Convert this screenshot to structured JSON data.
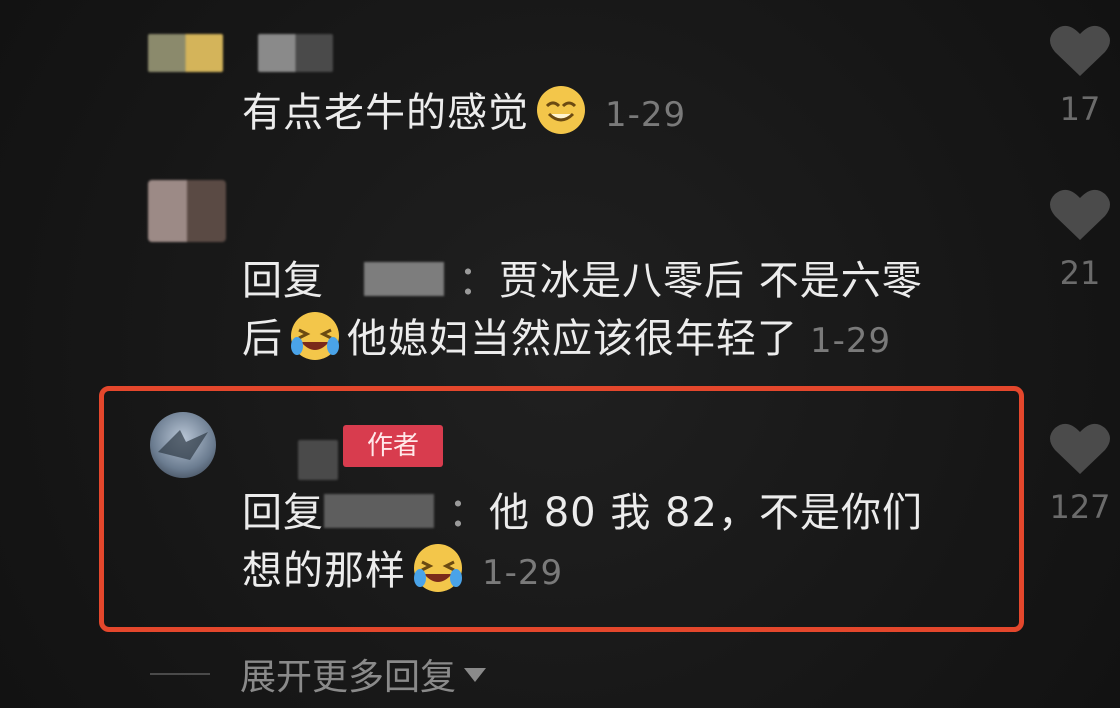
{
  "comments": [
    {
      "text": "有点老牛的感觉",
      "emoji": "grinning-emoji",
      "date": "1-29",
      "likes": "17"
    },
    {
      "reply_prefix": "回复",
      "text_line1": "贾冰是八零后 不是六零",
      "text_line2_a": "后",
      "text_line2_b": "他媳妇当然应该很年轻了",
      "emoji": "laughing-crying-emoji",
      "date": "1-29",
      "likes": "21"
    },
    {
      "badge": "作者",
      "reply_prefix": "回复",
      "text_line1": "他 80 我 82，不是你们",
      "text_line2": "想的那样",
      "emoji": "laughing-crying-emoji",
      "date": "1-29",
      "likes": "127"
    }
  ],
  "expand_label": "展开更多回复",
  "colors": {
    "highlight": "#e4472c",
    "badge": "#d83c4e",
    "background": "#181818"
  }
}
